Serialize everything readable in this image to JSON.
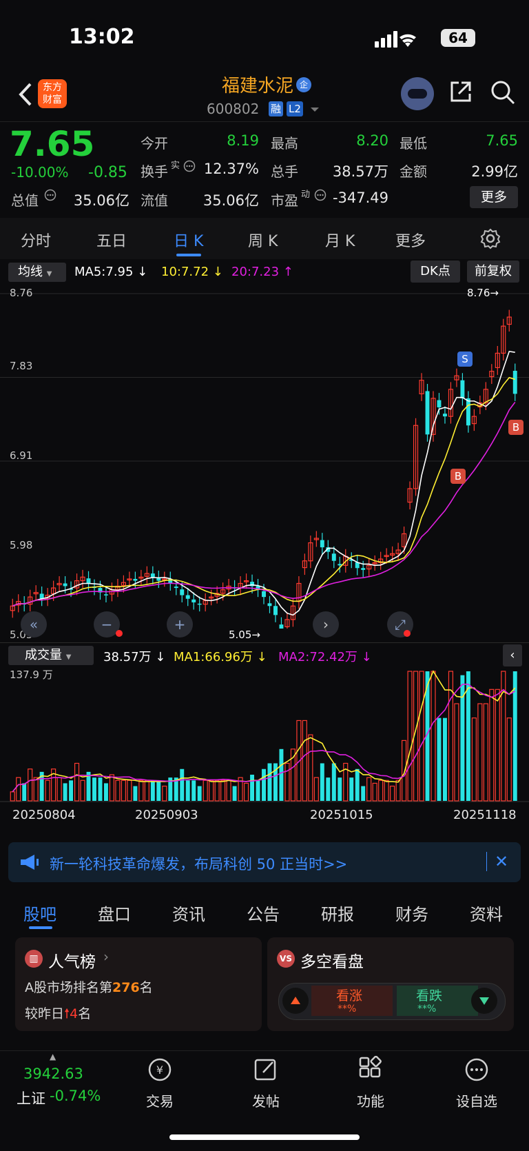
{
  "status_bar": {
    "time": "13:02",
    "battery": "64"
  },
  "header": {
    "logo_line1": "东方",
    "logo_line2": "财富",
    "stock_name": "福建水泥",
    "enterprise_badge": "企",
    "stock_code": "600802",
    "tag_margin": "融",
    "tag_level": "L2"
  },
  "quote": {
    "price": "7.65",
    "change_pct": "-10.00%",
    "change_amt": "-0.85",
    "fields": {
      "open_label": "今开",
      "open": "8.19",
      "high_label": "最高",
      "high": "8.20",
      "low_label": "最低",
      "low": "7.65",
      "turnover_label": "换手",
      "turnover_sup": "实",
      "turnover": "12.37%",
      "volume_label": "总手",
      "volume": "38.57万",
      "amount_label": "金额",
      "amount": "2.99亿",
      "mktcap_label": "总值",
      "mktcap": "35.06亿",
      "float_label": "流值",
      "float_cap": "35.06亿",
      "pe_label": "市盈",
      "pe_sup": "动",
      "pe": "-347.49"
    },
    "more_label": "更多"
  },
  "kline_tabs": [
    "分时",
    "五日",
    "日 K",
    "周 K",
    "月 K",
    "更多"
  ],
  "kline_active": "日 K",
  "ma_bar": {
    "select": "均线",
    "ma5": "MA5:7.95 ↓",
    "ma10": "10:7.72 ↓",
    "ma20": "20:7.23 ↑",
    "dk_label": "DK点",
    "adjust_label": "前复权"
  },
  "price_axis": [
    "8.76",
    "7.83",
    "6.91",
    "5.98",
    "5.05"
  ],
  "price_high_marker": "8.76→",
  "price_low_marker": "5.05→",
  "signal_markers": {
    "sell": "S",
    "buy": "B"
  },
  "volume_bar": {
    "select": "成交量",
    "vol": "38.57万 ↓",
    "ma1": "MA1:66.96万 ↓",
    "ma2": "MA2:72.42万 ↓",
    "axis_max": "137.9 万"
  },
  "dates": [
    "20250804",
    "20250903",
    "20251015",
    "20251118"
  ],
  "colors": {
    "up": "#ff3b30",
    "down": "#29e3e3",
    "ma5": "#ffffff",
    "ma10": "#ffee33",
    "ma20": "#e020e0",
    "accent": "#3d8bff",
    "price_down": "#24d03b"
  },
  "banner": {
    "text": "新一轮科技革命爆发，布局科创 50 正当时>>"
  },
  "section_tabs": [
    "股吧",
    "盘口",
    "资讯",
    "公告",
    "研报",
    "财务",
    "资料"
  ],
  "section_active": "股吧",
  "rank_card": {
    "title": "人气榜",
    "line1_prefix": "A股市场排名第",
    "rank": "276",
    "line1_suffix": "名",
    "line2_prefix": "较昨日",
    "change": "4",
    "line2_suffix": "名"
  },
  "vs_card": {
    "title": "多空看盘",
    "bull": "看涨",
    "bull_pct": "**%",
    "bear": "看跌",
    "bear_pct": "**%"
  },
  "bottom_nav": {
    "index_value": "3942.63",
    "index_name": "上证",
    "index_change": "-0.74%",
    "items": [
      "交易",
      "发帖",
      "功能",
      "设自选"
    ]
  },
  "chart_data": {
    "type": "candlestick",
    "title": "",
    "x_range": [
      "20250804",
      "20251118"
    ],
    "ylim": [
      5.05,
      8.76
    ],
    "closes": [
      5.3,
      5.35,
      5.32,
      5.4,
      5.45,
      5.38,
      5.42,
      5.5,
      5.55,
      5.52,
      5.48,
      5.58,
      5.62,
      5.55,
      5.5,
      5.45,
      5.42,
      5.48,
      5.52,
      5.56,
      5.6,
      5.58,
      5.62,
      5.66,
      5.62,
      5.58,
      5.6,
      5.55,
      5.5,
      5.42,
      5.38,
      5.34,
      5.32,
      5.36,
      5.4,
      5.44,
      5.48,
      5.52,
      5.5,
      5.55,
      5.58,
      5.52,
      5.48,
      5.4,
      5.3,
      5.2,
      5.05,
      5.15,
      5.3,
      5.55,
      5.8,
      6.0,
      6.05,
      5.95,
      5.9,
      5.8,
      5.75,
      5.85,
      5.8,
      5.72,
      5.7,
      5.75,
      5.78,
      5.82,
      5.86,
      5.88,
      5.92,
      6.1,
      6.6,
      7.3,
      7.8,
      7.2,
      7.6,
      7.5,
      7.4,
      7.7,
      7.85,
      7.6,
      7.3,
      7.4,
      7.55,
      7.7,
      7.9,
      8.1,
      8.4,
      8.5,
      7.65
    ],
    "volume_axis_max": "137.9万",
    "ma5_last": 7.95,
    "ma10_last": 7.72,
    "ma20_last": 7.23,
    "volume_last": "38.57万",
    "vol_ma1": "66.96万",
    "vol_ma2": "72.42万"
  }
}
